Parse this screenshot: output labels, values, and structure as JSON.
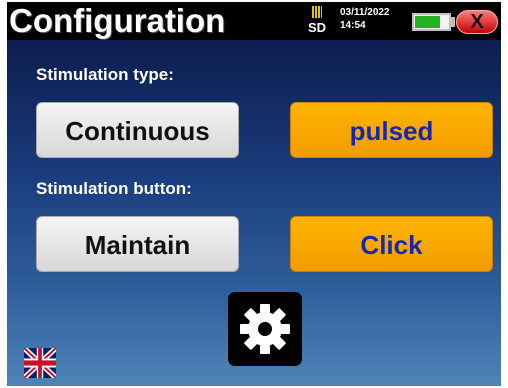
{
  "header": {
    "title": "Configuration",
    "sd_label": "SD",
    "date": "03/11/2022",
    "time": "14:54",
    "battery_level": 0.7,
    "close_label": "X"
  },
  "stimulation_type": {
    "label": "Stimulation type:",
    "options": [
      "Continuous",
      "pulsed"
    ],
    "selected": "pulsed"
  },
  "stimulation_button": {
    "label": "Stimulation button:",
    "options": [
      "Maintain",
      "Click"
    ],
    "selected": "Click"
  },
  "icons": {
    "settings": "gear-icon",
    "language": "uk-flag-icon",
    "storage": "sd-card-icon",
    "battery": "battery-icon"
  },
  "colors": {
    "selected_bg": "#f5a800",
    "selected_text": "#1428b8",
    "unselected_bg": "#e0e0e0",
    "battery_green": "#22b21f",
    "close_red": "#d40000"
  }
}
